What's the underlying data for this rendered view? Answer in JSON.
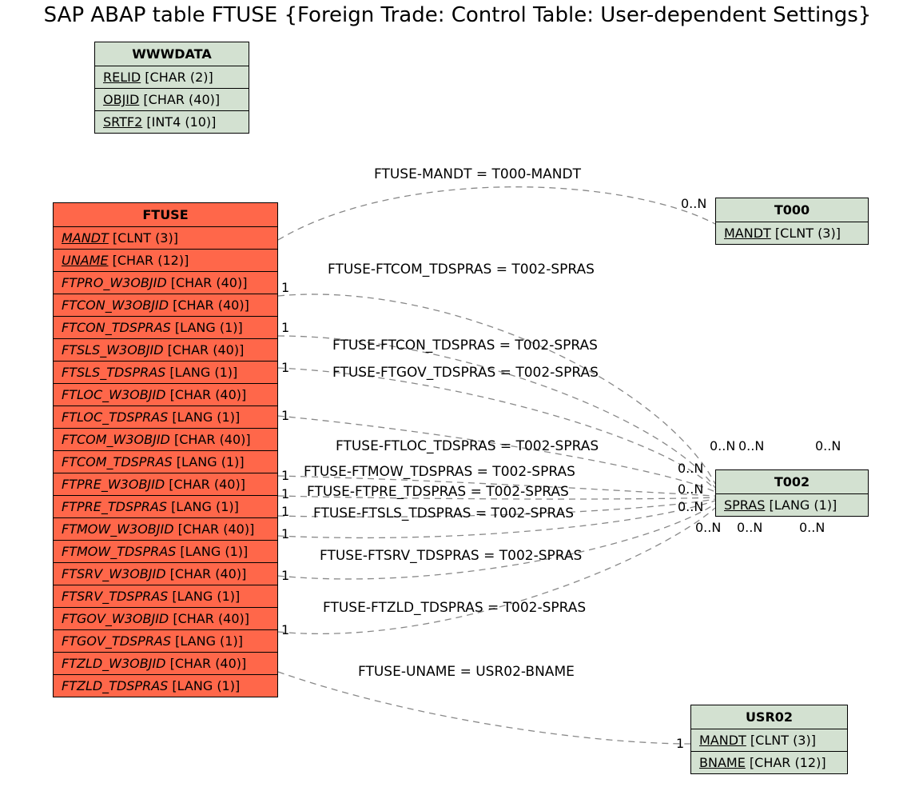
{
  "title": "SAP ABAP table FTUSE {Foreign Trade: Control Table: User-dependent Settings}",
  "entities": {
    "wwwdata": {
      "name": "WWWDATA",
      "fields": [
        {
          "name": "RELID",
          "type": "[CHAR (2)]",
          "key": true
        },
        {
          "name": "OBJID",
          "type": "[CHAR (40)]",
          "key": true
        },
        {
          "name": "SRTF2",
          "type": "[INT4 (10)]",
          "key": true
        }
      ]
    },
    "ftuse": {
      "name": "FTUSE",
      "fields": [
        {
          "name": "MANDT",
          "type": "[CLNT (3)]",
          "key": true,
          "ital": true
        },
        {
          "name": "UNAME",
          "type": "[CHAR (12)]",
          "key": true,
          "ital": true
        },
        {
          "name": "FTPRO_W3OBJID",
          "type": "[CHAR (40)]",
          "ital": true
        },
        {
          "name": "FTCON_W3OBJID",
          "type": "[CHAR (40)]",
          "ital": true
        },
        {
          "name": "FTCON_TDSPRAS",
          "type": "[LANG (1)]",
          "ital": true
        },
        {
          "name": "FTSLS_W3OBJID",
          "type": "[CHAR (40)]",
          "ital": true
        },
        {
          "name": "FTSLS_TDSPRAS",
          "type": "[LANG (1)]",
          "ital": true
        },
        {
          "name": "FTLOC_W3OBJID",
          "type": "[CHAR (40)]",
          "ital": true
        },
        {
          "name": "FTLOC_TDSPRAS",
          "type": "[LANG (1)]",
          "ital": true
        },
        {
          "name": "FTCOM_W3OBJID",
          "type": "[CHAR (40)]",
          "ital": true
        },
        {
          "name": "FTCOM_TDSPRAS",
          "type": "[LANG (1)]",
          "ital": true
        },
        {
          "name": "FTPRE_W3OBJID",
          "type": "[CHAR (40)]",
          "ital": true
        },
        {
          "name": "FTPRE_TDSPRAS",
          "type": "[LANG (1)]",
          "ital": true
        },
        {
          "name": "FTMOW_W3OBJID",
          "type": "[CHAR (40)]",
          "ital": true
        },
        {
          "name": "FTMOW_TDSPRAS",
          "type": "[LANG (1)]",
          "ital": true
        },
        {
          "name": "FTSRV_W3OBJID",
          "type": "[CHAR (40)]",
          "ital": true
        },
        {
          "name": "FTSRV_TDSPRAS",
          "type": "[LANG (1)]",
          "ital": true
        },
        {
          "name": "FTGOV_W3OBJID",
          "type": "[CHAR (40)]",
          "ital": true
        },
        {
          "name": "FTGOV_TDSPRAS",
          "type": "[LANG (1)]",
          "ital": true
        },
        {
          "name": "FTZLD_W3OBJID",
          "type": "[CHAR (40)]",
          "ital": true
        },
        {
          "name": "FTZLD_TDSPRAS",
          "type": "[LANG (1)]",
          "ital": true
        }
      ]
    },
    "t000": {
      "name": "T000",
      "fields": [
        {
          "name": "MANDT",
          "type": "[CLNT (3)]",
          "key": true
        }
      ]
    },
    "t002": {
      "name": "T002",
      "fields": [
        {
          "name": "SPRAS",
          "type": "[LANG (1)]",
          "key": true
        }
      ]
    },
    "usr02": {
      "name": "USR02",
      "fields": [
        {
          "name": "MANDT",
          "type": "[CLNT (3)]",
          "key": true
        },
        {
          "name": "BNAME",
          "type": "[CHAR (12)]",
          "key": true
        }
      ]
    }
  },
  "relations": {
    "r1": "FTUSE-MANDT = T000-MANDT",
    "r2": "FTUSE-FTCOM_TDSPRAS = T002-SPRAS",
    "r3": "FTUSE-FTCON_TDSPRAS = T002-SPRAS",
    "r4": "FTUSE-FTGOV_TDSPRAS = T002-SPRAS",
    "r5": "FTUSE-FTLOC_TDSPRAS = T002-SPRAS",
    "r6": "FTUSE-FTMOW_TDSPRAS = T002-SPRAS",
    "r7": "FTUSE-FTPRE_TDSPRAS = T002-SPRAS",
    "r8": "FTUSE-FTSLS_TDSPRAS = T002-SPRAS",
    "r9": "FTUSE-FTSRV_TDSPRAS = T002-SPRAS",
    "r10": "FTUSE-FTZLD_TDSPRAS = T002-SPRAS",
    "r11": "FTUSE-UNAME = USR02-BNAME"
  },
  "cardinality": {
    "one": "1",
    "many": "0..N"
  },
  "chart_data": {
    "type": "er-diagram",
    "main_table": "FTUSE",
    "tables": [
      {
        "name": "WWWDATA",
        "color": "green",
        "columns": [
          {
            "name": "RELID",
            "type": "CHAR",
            "len": 2,
            "pk": true
          },
          {
            "name": "OBJID",
            "type": "CHAR",
            "len": 40,
            "pk": true
          },
          {
            "name": "SRTF2",
            "type": "INT4",
            "len": 10,
            "pk": true
          }
        ]
      },
      {
        "name": "FTUSE",
        "color": "orange",
        "columns": [
          {
            "name": "MANDT",
            "type": "CLNT",
            "len": 3,
            "pk": true
          },
          {
            "name": "UNAME",
            "type": "CHAR",
            "len": 12,
            "pk": true
          },
          {
            "name": "FTPRO_W3OBJID",
            "type": "CHAR",
            "len": 40
          },
          {
            "name": "FTCON_W3OBJID",
            "type": "CHAR",
            "len": 40
          },
          {
            "name": "FTCON_TDSPRAS",
            "type": "LANG",
            "len": 1
          },
          {
            "name": "FTSLS_W3OBJID",
            "type": "CHAR",
            "len": 40
          },
          {
            "name": "FTSLS_TDSPRAS",
            "type": "LANG",
            "len": 1
          },
          {
            "name": "FTLOC_W3OBJID",
            "type": "CHAR",
            "len": 40
          },
          {
            "name": "FTLOC_TDSPRAS",
            "type": "LANG",
            "len": 1
          },
          {
            "name": "FTCOM_W3OBJID",
            "type": "CHAR",
            "len": 40
          },
          {
            "name": "FTCOM_TDSPRAS",
            "type": "LANG",
            "len": 1
          },
          {
            "name": "FTPRE_W3OBJID",
            "type": "CHAR",
            "len": 40
          },
          {
            "name": "FTPRE_TDSPRAS",
            "type": "LANG",
            "len": 1
          },
          {
            "name": "FTMOW_W3OBJID",
            "type": "CHAR",
            "len": 40
          },
          {
            "name": "FTMOW_TDSPRAS",
            "type": "LANG",
            "len": 1
          },
          {
            "name": "FTSRV_W3OBJID",
            "type": "CHAR",
            "len": 40
          },
          {
            "name": "FTSRV_TDSPRAS",
            "type": "LANG",
            "len": 1
          },
          {
            "name": "FTGOV_W3OBJID",
            "type": "CHAR",
            "len": 40
          },
          {
            "name": "FTGOV_TDSPRAS",
            "type": "LANG",
            "len": 1
          },
          {
            "name": "FTZLD_W3OBJID",
            "type": "CHAR",
            "len": 40
          },
          {
            "name": "FTZLD_TDSPRAS",
            "type": "LANG",
            "len": 1
          }
        ]
      },
      {
        "name": "T000",
        "color": "green",
        "columns": [
          {
            "name": "MANDT",
            "type": "CLNT",
            "len": 3,
            "pk": true
          }
        ]
      },
      {
        "name": "T002",
        "color": "green",
        "columns": [
          {
            "name": "SPRAS",
            "type": "LANG",
            "len": 1,
            "pk": true
          }
        ]
      },
      {
        "name": "USR02",
        "color": "green",
        "columns": [
          {
            "name": "MANDT",
            "type": "CLNT",
            "len": 3,
            "pk": true
          },
          {
            "name": "BNAME",
            "type": "CHAR",
            "len": 12,
            "pk": true
          }
        ]
      }
    ],
    "relationships": [
      {
        "from": "FTUSE.MANDT",
        "to": "T000.MANDT",
        "from_card": "1",
        "to_card": "0..N"
      },
      {
        "from": "FTUSE.FTCOM_TDSPRAS",
        "to": "T002.SPRAS",
        "from_card": "1",
        "to_card": "0..N"
      },
      {
        "from": "FTUSE.FTCON_TDSPRAS",
        "to": "T002.SPRAS",
        "from_card": "1",
        "to_card": "0..N"
      },
      {
        "from": "FTUSE.FTGOV_TDSPRAS",
        "to": "T002.SPRAS",
        "from_card": "1",
        "to_card": "0..N"
      },
      {
        "from": "FTUSE.FTLOC_TDSPRAS",
        "to": "T002.SPRAS",
        "from_card": "1",
        "to_card": "0..N"
      },
      {
        "from": "FTUSE.FTMOW_TDSPRAS",
        "to": "T002.SPRAS",
        "from_card": "1",
        "to_card": "0..N"
      },
      {
        "from": "FTUSE.FTPRE_TDSPRAS",
        "to": "T002.SPRAS",
        "from_card": "1",
        "to_card": "0..N"
      },
      {
        "from": "FTUSE.FTSLS_TDSPRAS",
        "to": "T002.SPRAS",
        "from_card": "1",
        "to_card": "0..N"
      },
      {
        "from": "FTUSE.FTSRV_TDSPRAS",
        "to": "T002.SPRAS",
        "from_card": "1",
        "to_card": "0..N"
      },
      {
        "from": "FTUSE.FTZLD_TDSPRAS",
        "to": "T002.SPRAS",
        "from_card": "1",
        "to_card": "0..N"
      },
      {
        "from": "FTUSE.UNAME",
        "to": "USR02.BNAME",
        "from_card": "1",
        "to_card": "1"
      }
    ]
  }
}
